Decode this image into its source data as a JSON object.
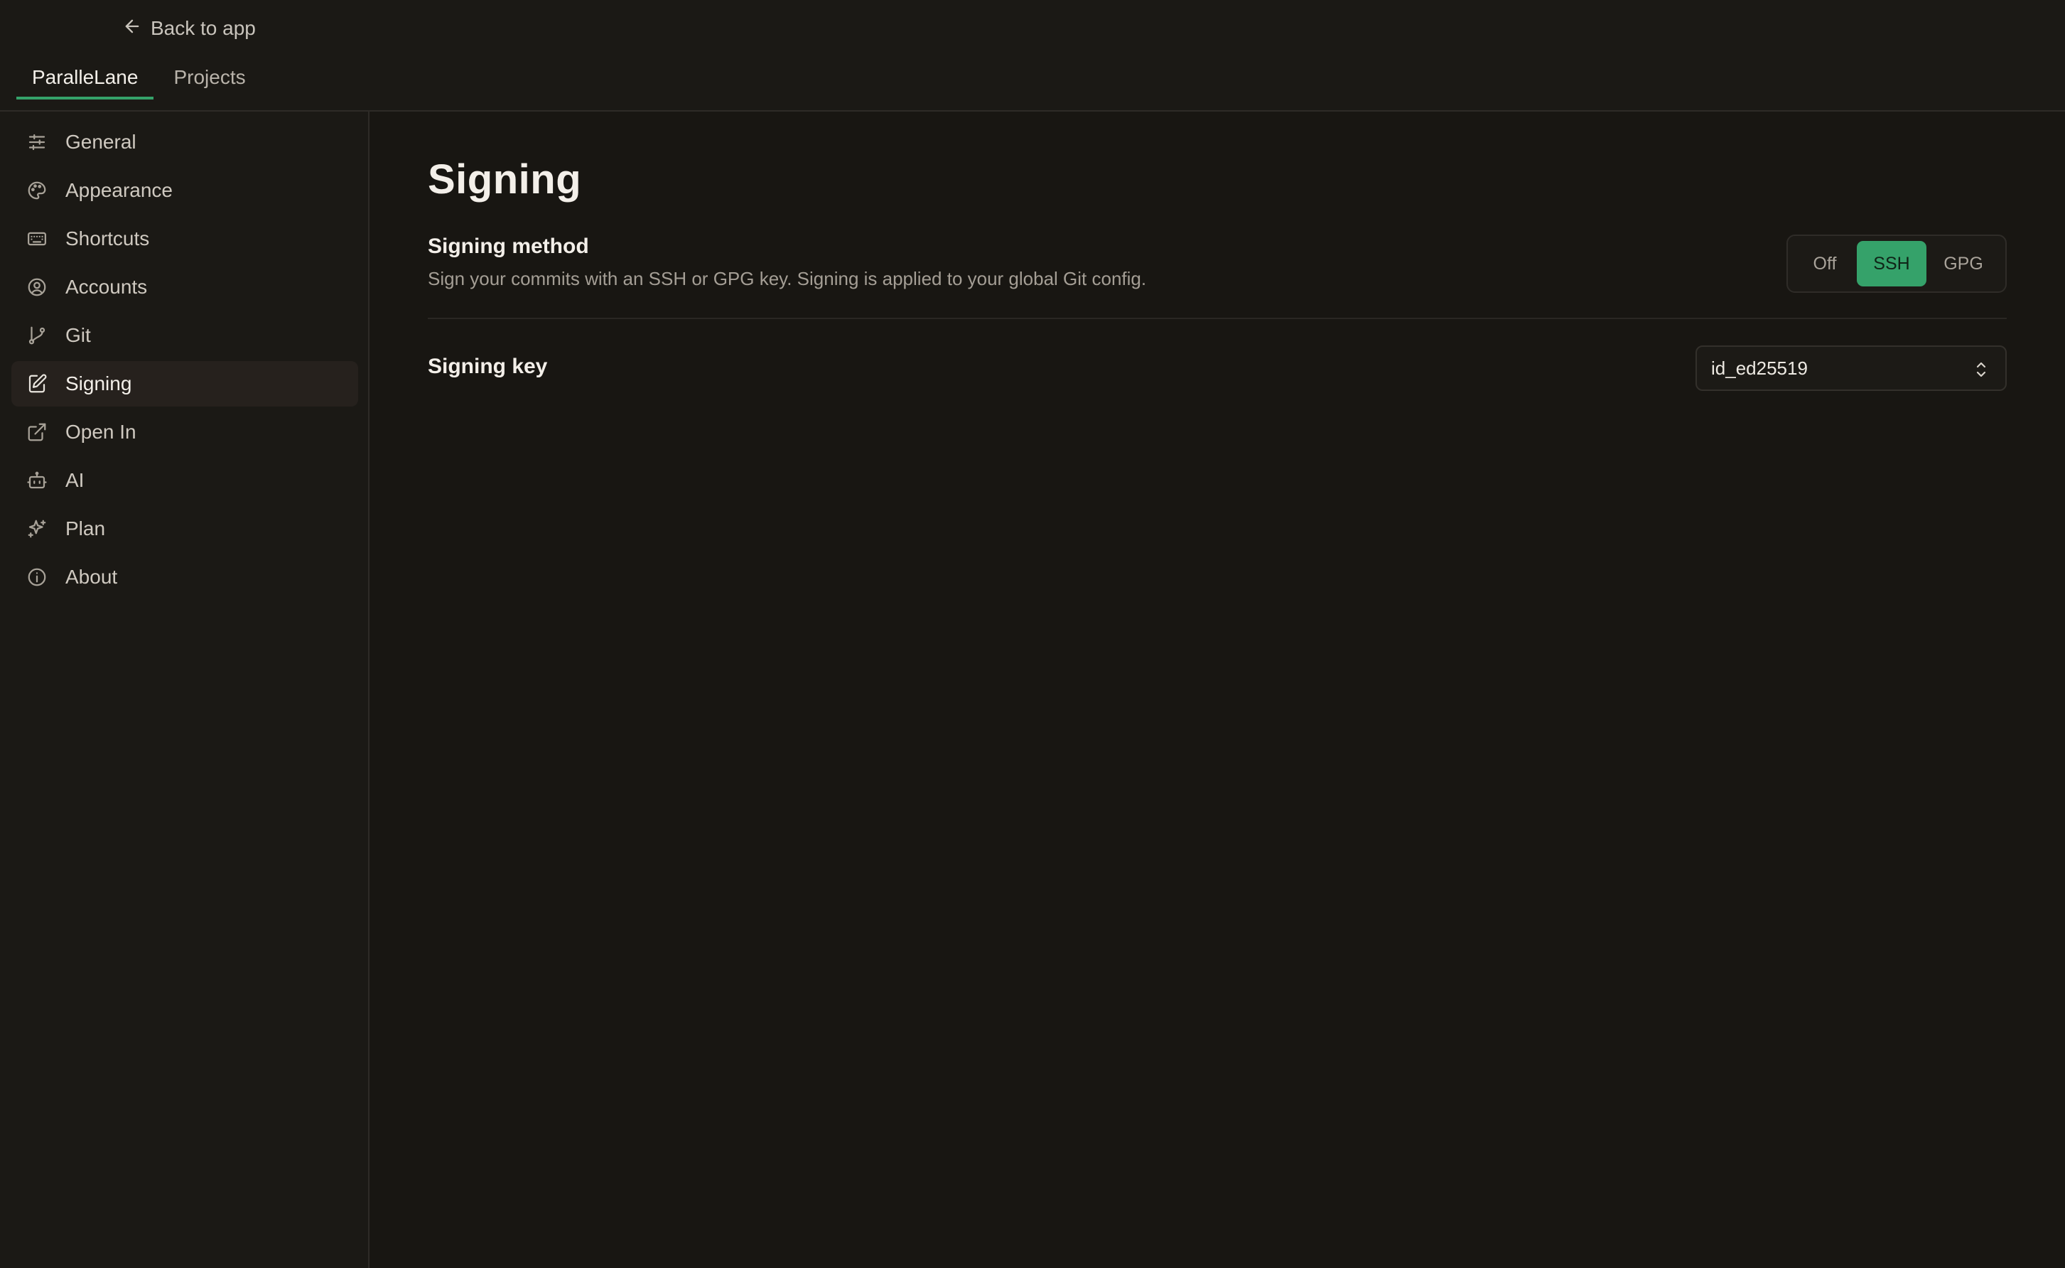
{
  "topbar": {
    "back_label": "Back to app",
    "tabs": [
      {
        "label": "ParalleLane",
        "active": true
      },
      {
        "label": "Projects",
        "active": false
      }
    ],
    "accent_color": "#35a26a"
  },
  "sidebar": {
    "items": [
      {
        "label": "General",
        "icon": "sliders-icon"
      },
      {
        "label": "Appearance",
        "icon": "palette-icon"
      },
      {
        "label": "Shortcuts",
        "icon": "keyboard-icon"
      },
      {
        "label": "Accounts",
        "icon": "user-circle-icon"
      },
      {
        "label": "Git",
        "icon": "git-branch-icon"
      },
      {
        "label": "Signing",
        "icon": "pen-square-icon",
        "active": true
      },
      {
        "label": "Open In",
        "icon": "external-link-icon"
      },
      {
        "label": "AI",
        "icon": "bot-icon"
      },
      {
        "label": "Plan",
        "icon": "sparkles-icon"
      },
      {
        "label": "About",
        "icon": "info-icon"
      }
    ]
  },
  "main": {
    "title": "Signing",
    "signing_method": {
      "title": "Signing method",
      "description": "Sign your commits with an SSH or GPG key. Signing is applied to your global Git config.",
      "options": [
        "Off",
        "SSH",
        "GPG"
      ],
      "selected": "SSH"
    },
    "signing_key": {
      "title": "Signing key",
      "value": "id_ed25519"
    }
  }
}
